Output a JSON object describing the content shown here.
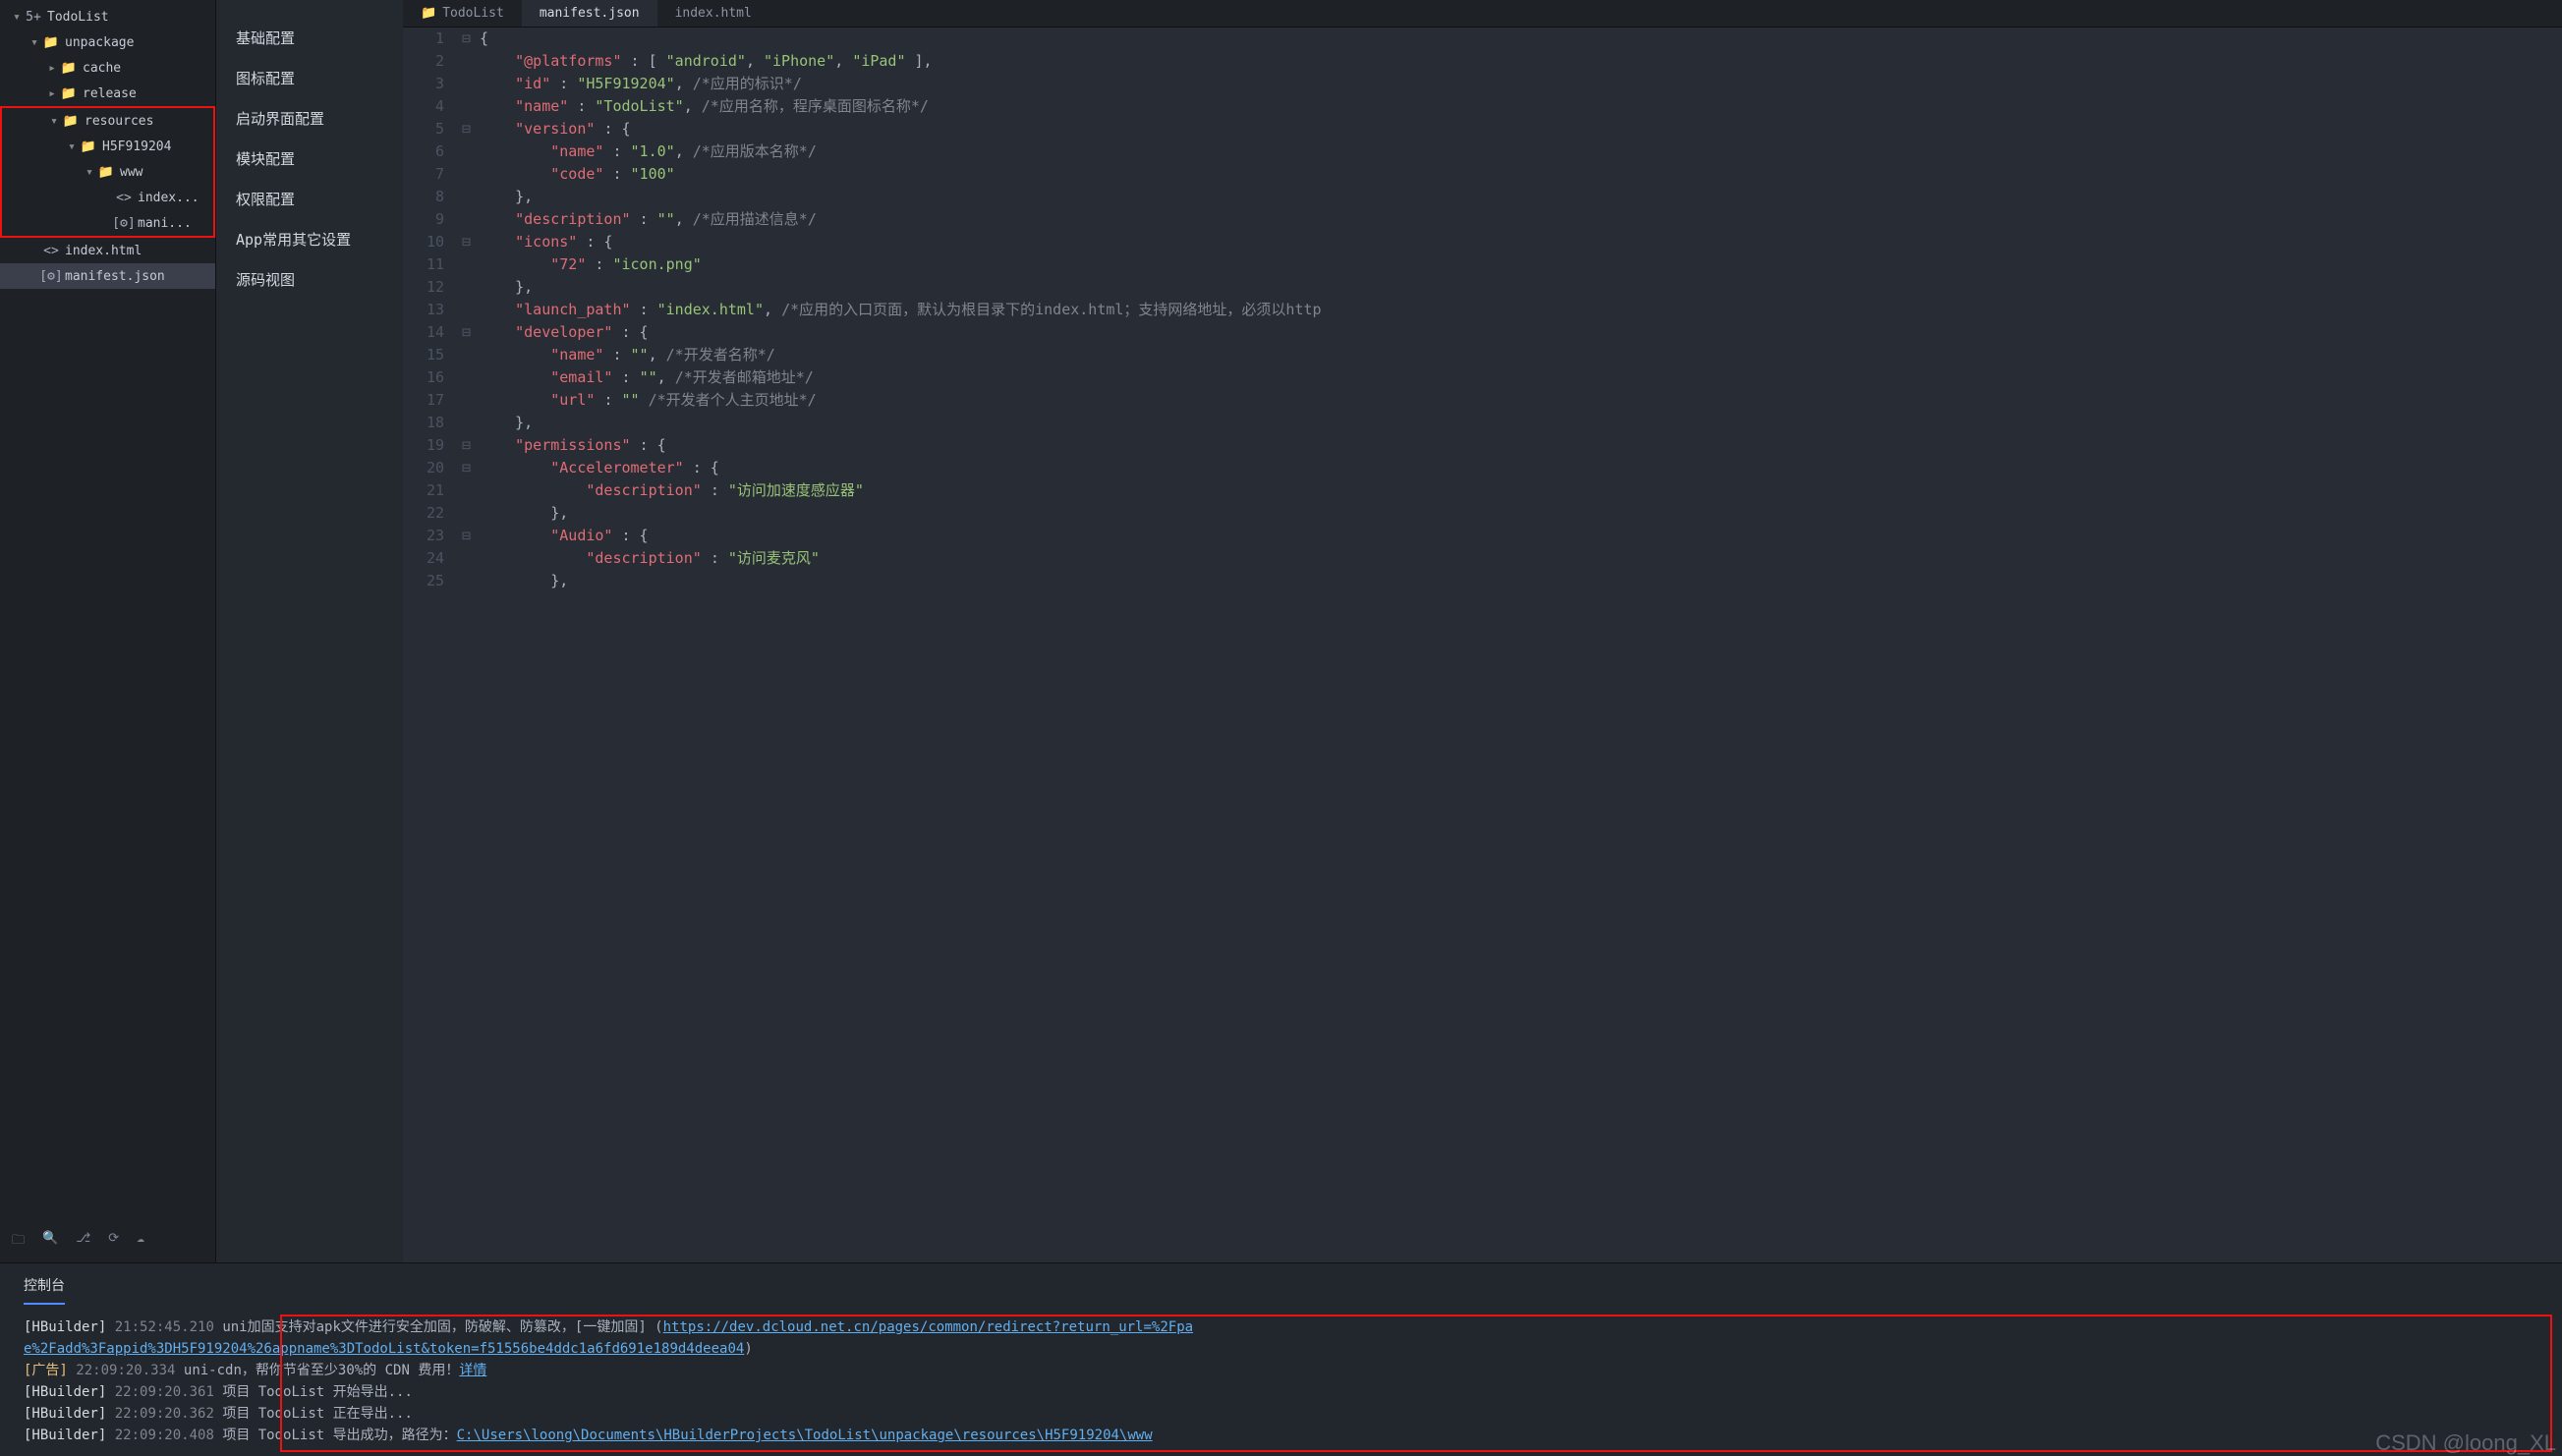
{
  "tree": {
    "root": "TodoList",
    "items": [
      {
        "depth": 0,
        "arrow": "▾",
        "icon": "5+",
        "label": "TodoList"
      },
      {
        "depth": 1,
        "arrow": "▾",
        "icon": "📁",
        "label": "unpackage"
      },
      {
        "depth": 2,
        "arrow": "▸",
        "icon": "📁",
        "label": "cache"
      },
      {
        "depth": 2,
        "arrow": "▸",
        "icon": "📁",
        "label": "release"
      },
      {
        "depth": 2,
        "arrow": "▾",
        "icon": "📁",
        "label": "resources",
        "hl_start": true
      },
      {
        "depth": 3,
        "arrow": "▾",
        "icon": "📁",
        "label": "H5F919204"
      },
      {
        "depth": 4,
        "arrow": "▾",
        "icon": "📁",
        "label": "www"
      },
      {
        "depth": 5,
        "arrow": "",
        "icon": "<>",
        "label": "index..."
      },
      {
        "depth": 5,
        "arrow": "",
        "icon": "[⚙]",
        "label": "mani...",
        "hl_end": true
      },
      {
        "depth": 1,
        "arrow": "",
        "icon": "<>",
        "label": "index.html"
      },
      {
        "depth": 1,
        "arrow": "",
        "icon": "[⚙]",
        "label": "manifest.json",
        "selected": true
      }
    ]
  },
  "sidebar_icons": [
    "folder-move-icon",
    "binoculars-icon",
    "branch-icon",
    "sync-icon",
    "cloud-icon"
  ],
  "nav": [
    "基础配置",
    "图标配置",
    "启动界面配置",
    "模块配置",
    "权限配置",
    "App常用其它设置",
    "源码视图"
  ],
  "tabs": [
    {
      "icon": "📁",
      "label": "TodoList",
      "active": false
    },
    {
      "icon": "",
      "label": "manifest.json",
      "active": true
    },
    {
      "icon": "",
      "label": "index.html",
      "active": false
    }
  ],
  "code": {
    "lines": [
      {
        "n": 1,
        "fold": "⊟",
        "html": "<span class='tok-punc'>{</span>"
      },
      {
        "n": 2,
        "fold": "",
        "html": "    <span class='tok-key'>\"@platforms\"</span> <span class='tok-punc'>: [</span> <span class='tok-str'>\"android\"</span><span class='tok-punc'>,</span> <span class='tok-str'>\"iPhone\"</span><span class='tok-punc'>,</span> <span class='tok-str'>\"iPad\"</span> <span class='tok-punc'>],</span>"
      },
      {
        "n": 3,
        "fold": "",
        "html": "    <span class='tok-key'>\"id\"</span> <span class='tok-punc'>:</span> <span class='tok-str'>\"H5F919204\"</span><span class='tok-punc'>,</span> <span class='tok-cmt'>/*应用的标识*/</span>"
      },
      {
        "n": 4,
        "fold": "",
        "html": "    <span class='tok-key'>\"name\"</span> <span class='tok-punc'>:</span> <span class='tok-str'>\"TodoList\"</span><span class='tok-punc'>,</span> <span class='tok-cmt'>/*应用名称，程序桌面图标名称*/</span>"
      },
      {
        "n": 5,
        "fold": "⊟",
        "html": "    <span class='tok-key'>\"version\"</span> <span class='tok-punc'>: {</span>"
      },
      {
        "n": 6,
        "fold": "",
        "html": "        <span class='tok-key'>\"name\"</span> <span class='tok-punc'>:</span> <span class='tok-str'>\"1.0\"</span><span class='tok-punc'>,</span> <span class='tok-cmt'>/*应用版本名称*/</span>"
      },
      {
        "n": 7,
        "fold": "",
        "html": "        <span class='tok-key'>\"code\"</span> <span class='tok-punc'>:</span> <span class='tok-str'>\"100\"</span>"
      },
      {
        "n": 8,
        "fold": "",
        "html": "    <span class='tok-punc'>},</span>"
      },
      {
        "n": 9,
        "fold": "",
        "html": "    <span class='tok-key'>\"description\"</span> <span class='tok-punc'>:</span> <span class='tok-str'>\"\"</span><span class='tok-punc'>,</span> <span class='tok-cmt'>/*应用描述信息*/</span>"
      },
      {
        "n": 10,
        "fold": "⊟",
        "html": "    <span class='tok-key'>\"icons\"</span> <span class='tok-punc'>: {</span>"
      },
      {
        "n": 11,
        "fold": "",
        "html": "        <span class='tok-key'>\"72\"</span> <span class='tok-punc'>:</span> <span class='tok-str'>\"icon.png\"</span>"
      },
      {
        "n": 12,
        "fold": "",
        "html": "    <span class='tok-punc'>},</span>"
      },
      {
        "n": 13,
        "fold": "",
        "html": "    <span class='tok-key'>\"launch_path\"</span> <span class='tok-punc'>:</span> <span class='tok-str'>\"index.html\"</span><span class='tok-punc'>,</span> <span class='tok-cmt'>/*应用的入口页面，默认为根目录下的index.html；支持网络地址，必须以http</span>"
      },
      {
        "n": 14,
        "fold": "⊟",
        "html": "    <span class='tok-key'>\"developer\"</span> <span class='tok-punc'>: {</span>"
      },
      {
        "n": 15,
        "fold": "",
        "html": "        <span class='tok-key'>\"name\"</span> <span class='tok-punc'>:</span> <span class='tok-str'>\"\"</span><span class='tok-punc'>,</span> <span class='tok-cmt'>/*开发者名称*/</span>"
      },
      {
        "n": 16,
        "fold": "",
        "html": "        <span class='tok-key'>\"email\"</span> <span class='tok-punc'>:</span> <span class='tok-str'>\"\"</span><span class='tok-punc'>,</span> <span class='tok-cmt'>/*开发者邮箱地址*/</span>"
      },
      {
        "n": 17,
        "fold": "",
        "html": "        <span class='tok-key'>\"url\"</span> <span class='tok-punc'>:</span> <span class='tok-str'>\"\"</span> <span class='tok-cmt'>/*开发者个人主页地址*/</span>"
      },
      {
        "n": 18,
        "fold": "",
        "html": "    <span class='tok-punc'>},</span>"
      },
      {
        "n": 19,
        "fold": "⊟",
        "html": "    <span class='tok-key'>\"permissions\"</span> <span class='tok-punc'>: {</span>"
      },
      {
        "n": 20,
        "fold": "⊟",
        "html": "        <span class='tok-key'>\"Accelerometer\"</span> <span class='tok-punc'>: {</span>"
      },
      {
        "n": 21,
        "fold": "",
        "html": "            <span class='tok-key'>\"description\"</span> <span class='tok-punc'>:</span> <span class='tok-str'>\"访问加速度感应器\"</span>"
      },
      {
        "n": 22,
        "fold": "",
        "html": "        <span class='tok-punc'>},</span>"
      },
      {
        "n": 23,
        "fold": "⊟",
        "html": "        <span class='tok-key'>\"Audio\"</span> <span class='tok-punc'>: {</span>"
      },
      {
        "n": 24,
        "fold": "",
        "html": "            <span class='tok-key'>\"description\"</span> <span class='tok-punc'>:</span> <span class='tok-str'>\"访问麦克风\"</span>"
      },
      {
        "n": 25,
        "fold": "",
        "html": "        <span class='tok-punc'>},</span>"
      }
    ]
  },
  "console": {
    "tab": "控制台",
    "lines": [
      {
        "tag": "[HBuilder]",
        "tagc": "tag-hb",
        "ts": "21:52:45.210",
        "body": "uni加固支持对apk文件进行安全加固，防破解、防篡改，[一键加固] (",
        "link": "https://dev.dcloud.net.cn/pages/common/redirect?return_url=%2Fpa",
        "tail": ""
      },
      {
        "cont": true,
        "link": "e%2Fadd%3Fappid%3DH5F919204%26appname%3DTodoList&token=f51556be4ddc1a6fd691e189d4deea04",
        "tail": ")"
      },
      {
        "tag": "[广告]",
        "tagc": "tag-ad",
        "ts": "22:09:20.334",
        "body": "uni-cdn，帮你节省至少30%的 CDN 费用！",
        "link": "详情",
        "tail": ""
      },
      {
        "tag": "[HBuilder]",
        "tagc": "tag-hb",
        "ts": "22:09:20.361",
        "body": "项目 TodoList 开始导出..."
      },
      {
        "tag": "[HBuilder]",
        "tagc": "tag-hb",
        "ts": "22:09:20.362",
        "body": "项目 TodoList 正在导出..."
      },
      {
        "tag": "[HBuilder]",
        "tagc": "tag-hb",
        "ts": "22:09:20.408",
        "body": "项目 TodoList 导出成功，路径为：",
        "link": "C:\\Users\\loong\\Documents\\HBuilderProjects\\TodoList\\unpackage\\resources\\H5F919204\\www"
      }
    ],
    "watermark": "CSDN @loong_XL"
  }
}
